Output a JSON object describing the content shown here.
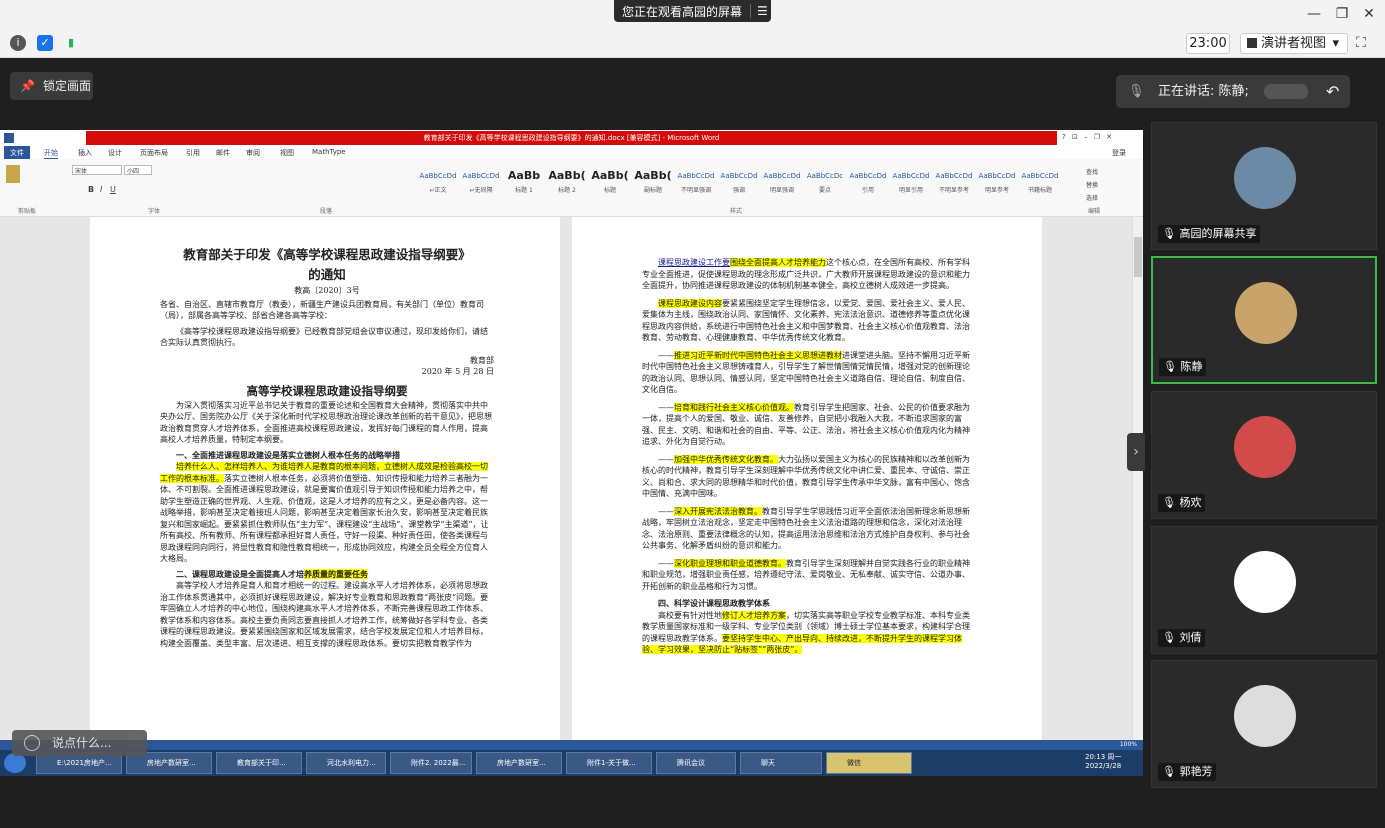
{
  "topbar": {
    "share_banner": "您正在观看高园的屏幕",
    "menu_glyph": "☰",
    "win_minimize": "—",
    "win_restore": "❐",
    "win_close": "✕"
  },
  "toolbar": {
    "time": "23:00",
    "presenter_view": "演讲者视图",
    "presenter_caret": "▾",
    "fullscreen": "⛶"
  },
  "lock_button": "锁定画面",
  "speaking": {
    "label": "正在讲话: 陈静;",
    "back_glyph": "↶"
  },
  "word": {
    "title": "教育部关于印发《高等学校课程思政建设指导纲要》的通知.docx [兼容模式] - Microsoft Word",
    "title_right": "?  ⊡  –  ❐  ✕",
    "menu": [
      "文件",
      "开始",
      "插入",
      "设计",
      "页面布局",
      "引用",
      "邮件",
      "审阅",
      "视图",
      "MathType"
    ],
    "login": "登录",
    "styles": [
      {
        "sample": "AaBbCcDd",
        "caption": "↵正文"
      },
      {
        "sample": "AaBbCcDd",
        "caption": "↵无间隔"
      },
      {
        "sample": "AaBb",
        "caption": "标题 1"
      },
      {
        "sample": "AaBb(",
        "caption": "标题 2"
      },
      {
        "sample": "AaBb(",
        "caption": "标题"
      },
      {
        "sample": "AaBb(",
        "caption": "副标题"
      },
      {
        "sample": "AaBbCcDd",
        "caption": "不明显强调"
      },
      {
        "sample": "AaBbCcDd",
        "caption": "强调"
      },
      {
        "sample": "AaBbCcDd",
        "caption": "明显强调"
      },
      {
        "sample": "AaBbCcDc",
        "caption": "要点"
      },
      {
        "sample": "AaBbCcDd",
        "caption": "引用"
      },
      {
        "sample": "AaBbCcDd",
        "caption": "明显引用"
      },
      {
        "sample": "AaBbCcDd",
        "caption": "不明显参考"
      },
      {
        "sample": "AaBbCcDd",
        "caption": "明显参考"
      },
      {
        "sample": "AaBbCcDd",
        "caption": "书籍标题"
      }
    ],
    "groups": [
      "剪贴板",
      "字体",
      "段落",
      "样式",
      "编辑"
    ],
    "font_name": "宋体",
    "font_size": "小四",
    "edit_items": [
      "查找",
      "替换",
      "选择"
    ],
    "statusbar_right": "100%",
    "page_left": {
      "title1": "教育部关于印发《高等学校课程思政建设指导纲要》",
      "title2": "的通知",
      "doc_no": "教高〔2020〕3号",
      "addressee": "各省、自治区、直辖市教育厅（教委），新疆生产建设兵团教育局，有关部门（单位）教育司（局），部属各高等学校、部省合建各高等学校：",
      "para1": "《高等学校课程思政建设指导纲要》已经教育部党组会议审议通过，现印发给你们，请结合实际认真贯彻执行。",
      "signer": "教育部",
      "date": "2020 年 5 月 28 日",
      "title3": "高等学校课程思政建设指导纲要",
      "para2": "为深入贯彻落实习近平总书记关于教育的重要论述和全国教育大会精神，贯彻落实中共中央办公厅、国务院办公厅《关于深化新时代学校思想政治理论课改革创新的若干意见》，把思想政治教育贯穿人才培养体系，全面推进高校课程思政建设，发挥好每门课程的育人作用，提高高校人才培养质量，特制定本纲要。",
      "head1": "一、全面推进课程思政建设是落实立德树人根本任务的战略举措",
      "para3_hl": "培养什么人、怎样培养人、为谁培养人是教育的根本问题，立德树人成效是检验高校一切工作的根本标准。",
      "para3": "落实立德树人根本任务，必须将价值塑造、知识传授和能力培养三者融为一体、不可割裂。全面推进课程思政建设，就是要寓价值观引导于知识传授和能力培养之中，帮助学生塑造正确的世界观、人生观、价值观，这是人才培养的应有之义，更是必备内容。这一战略举措，影响甚至决定着接班人问题，影响甚至决定着国家长治久安，影响甚至决定着民族复兴和国家崛起。要紧紧抓住教师队伍“主力军”、课程建设“主战场”、课堂教学“主渠道”，让所有高校、所有教师、所有课程都承担好育人责任，守好一段渠、种好责任田，使各类课程与思政课程同向同行，将显性教育和隐性教育相统一，形成协同效应，构建全员全程全方位育人大格局。",
      "head2a": "二、课程思政建设是全面提高人才培",
      "head2b": "养质量的重要任务",
      "para4": "高等学校人才培养是育人和育才相统一的过程。建设高水平人才培养体系，必须将思想政治工作体系贯通其中，必须抓好课程思政建设，解决好专业教育和思政教育“两张皮”问题。要牢固确立人才培养的中心地位，围绕构建高水平人才培养体系，不断完善课程思政工作体系、教学体系和内容体系。高校主要负责同志要直接抓人才培养工作，统筹做好各学科专业、各类课程的课程思政建设。要紧紧围绕国家和区域发展需求，结合学校发展定位和人才培养目标，构建全面覆盖、类型丰富、层次递进、相互支撑的课程思政体系。要切实把教育教学作为"
    },
    "page_right": {
      "p1a": "课程思政建设工作要",
      "p1hl": "围绕全面提高人才培养能力",
      "p1b": "这个核心点，在全国所有高校、所有学科专业全面推进，促使课程思政的理念形成广泛共识，广大教师开展课程思政建设的意识和能力全面提升，协同推进课程思政建设的体制机制基本健全，高校立德树人成效进一步提高。",
      "p2hl": "课程思政建设内容",
      "p2": "要紧紧围绕坚定学生理想信念，以爱党、爱国、爱社会主义、爱人民、爱集体为主线，围绕政治认同、家国情怀、文化素养、宪法法治意识、道德修养等重点优化课程思政内容供给，系统进行中国特色社会主义和中国梦教育、社会主义核心价值观教育、法治教育、劳动教育、心理健康教育、中华优秀传统文化教育。",
      "p3pre": "——",
      "p3hl": "推进习近平新时代中国特色社会主义思想进教材",
      "p3": "进课堂进头脑。坚持不懈用习近平新时代中国特色社会主义思想铸魂育人，引导学生了解世情国情党情民情，增强对党的创新理论的政治认同、思想认同、情感认同，坚定中国特色社会主义道路自信、理论自信、制度自信、文化自信。",
      "p4hl": "培育和践行社会主义核心价值观。",
      "p4": "教育引导学生把国家、社会、公民的价值要求融为一体，提高个人的爱国、敬业、诚信、友善修养，自觉把小我融入大我，不断追求国家的富强、民主、文明、和谐和社会的自由、平等、公正、法治，将社会主义核心价值观内化为精神追求、外化为自觉行动。",
      "p5hl": "加强中华优秀传统文化教育。",
      "p5": "大力弘扬以爱国主义为核心的民族精神和以改革创新为核心的时代精神，教育引导学生深刻理解中华优秀传统文化中讲仁爱、重民本、守诚信、崇正义、尚和合、求大同的思想精华和时代价值，教育引导学生传承中华文脉，富有中国心、饱含中国情、充满中国味。",
      "p6hl": "深入开展宪法法治教育。",
      "p6": "教育引导学生学思践悟习近平全面依法治国新理念新思想新战略，牢固树立法治观念，坚定走中国特色社会主义法治道路的理想和信念，深化对法治理念、法治原则、重要法律概念的认知，提高运用法治思维和法治方式维护自身权利、参与社会公共事务、化解矛盾纠纷的意识和能力。",
      "p7hl": "深化职业理想和职业道德教育。",
      "p7": "教育引导学生深刻理解并自觉实践各行业的职业精神和职业规范，增强职业责任感，培养遵纪守法、爱岗敬业、无私奉献、诚实守信、公道办事、开拓创新的职业品格和行为习惯。",
      "head4": "四、科学设计课程思政教学体系",
      "p8a": "高校要有针对性地",
      "p8hl": "修订人才培养方案",
      "p8b": "，切实落实高等职业学校专业教学标准、本科专业类教学质量国家标准和一级学科、专业学位类别（领域）博士硕士学位基本要求，构建科学合理的课程思政教学体系。",
      "p8hl2": "要坚持学生中心、产出导向、持续改进，不断提升学生的课程学习体验、学习效果，坚决防止“贴标签”“两张皮”。"
    }
  },
  "say_box": "说点什么...",
  "taskbar": {
    "items": [
      "E:\\2021房地产...",
      "房地产数研室...",
      "教育部关于印...",
      "河北水利电力...",
      "附件2. 2022最...",
      "房地产数研室...",
      "附件1-关于做...",
      "腾讯会议",
      "聊天",
      "微信"
    ],
    "time": "20:13 周一",
    "date": "2022/3/28"
  },
  "participants": [
    {
      "name": "高园的屏幕共享",
      "color": "#6a8aa5"
    },
    {
      "name": "陈静",
      "color": "#c9a46a"
    },
    {
      "name": "杨欢",
      "color": "#d14b4b"
    },
    {
      "name": "刘倩",
      "color": "#ffffff"
    },
    {
      "name": "郭艳芳",
      "color": "#dddddd"
    }
  ],
  "colors": {
    "word_title": "#d40b0b",
    "word_blue": "#2b579a",
    "highlight": "#ffff00",
    "active_border": "#3fb84f"
  }
}
